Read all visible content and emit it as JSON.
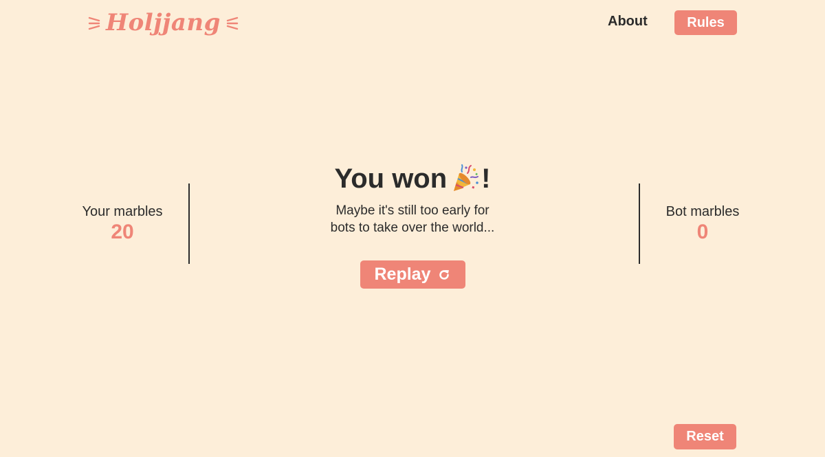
{
  "header": {
    "logo_text": "Holjjang",
    "nav": {
      "about_label": "About",
      "rules_label": "Rules"
    }
  },
  "scores": {
    "player": {
      "label": "Your marbles",
      "value": "20"
    },
    "bot": {
      "label": "Bot marbles",
      "value": "0"
    }
  },
  "result": {
    "title_prefix": "You won",
    "title_suffix": "!",
    "title_icon": "party-popper-icon",
    "message_line1": "Maybe it's still too early for",
    "message_line2": "bots to take over the world...",
    "replay_label": "Replay",
    "replay_icon": "refresh-icon"
  },
  "footer": {
    "reset_label": "Reset"
  },
  "colors": {
    "background": "#fdeed9",
    "accent": "#ef8577",
    "text": "#2b2b2b"
  }
}
